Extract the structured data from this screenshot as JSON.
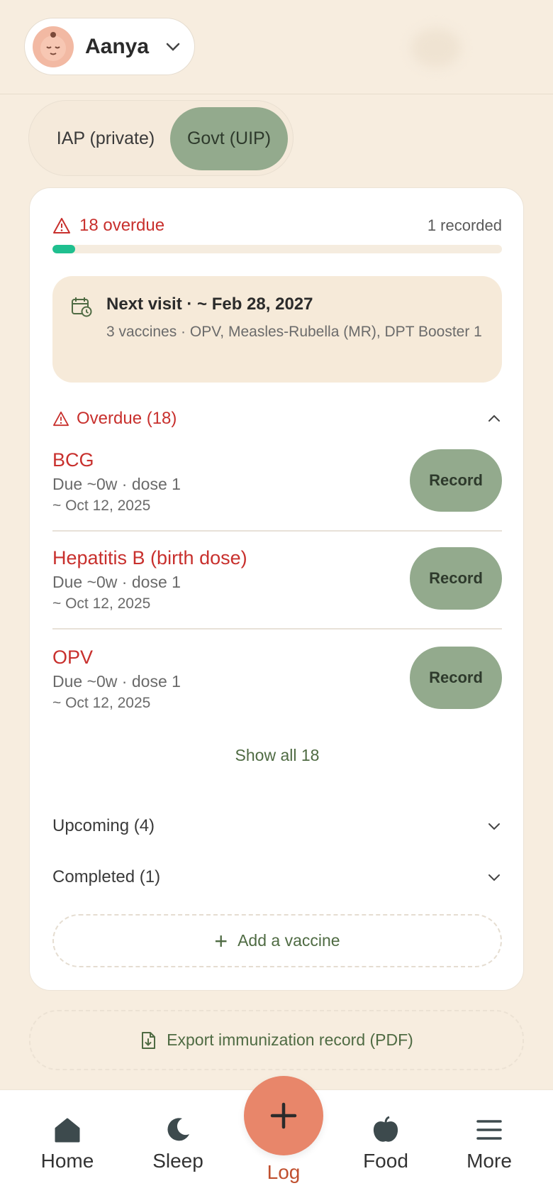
{
  "header": {
    "child_name": "Aanya"
  },
  "schedule_toggle": {
    "options": [
      "IAP (private)",
      "Govt (UIP)"
    ],
    "selected": "Govt (UIP)"
  },
  "summary": {
    "overdue_text": "18 overdue",
    "recorded_text": "1 recorded",
    "progress_fraction": 0.05,
    "progress_color": "#1fbf8f"
  },
  "next_visit": {
    "title": "Next visit · ~ Feb 28, 2027",
    "subtitle": "3 vaccines · OPV, Measles-Rubella (MR), DPT Booster 1"
  },
  "overdue_section": {
    "title": "Overdue (18)",
    "items": [
      {
        "name": "BCG",
        "due": "Due ~0w · dose 1",
        "date": "~ Oct 12, 2025",
        "action": "Record"
      },
      {
        "name": "Hepatitis B (birth dose)",
        "due": "Due ~0w · dose 1",
        "date": "~ Oct 12, 2025",
        "action": "Record"
      },
      {
        "name": "OPV",
        "due": "Due ~0w · dose 1",
        "date": "~ Oct 12, 2025",
        "action": "Record"
      }
    ],
    "show_all": "Show all 18"
  },
  "upcoming_section": {
    "title": "Upcoming (4)"
  },
  "completed_section": {
    "title": "Completed (1)"
  },
  "add_vaccine": "Add a vaccine",
  "export": "Export immunization record (PDF)",
  "bottom_nav": {
    "home": "Home",
    "sleep": "Sleep",
    "log": "Log",
    "food": "Food",
    "more": "More"
  },
  "colors": {
    "accent_green": "#93aa8d",
    "alert_red": "#c8302d",
    "fab": "#e8866a",
    "background": "#f7eddf"
  }
}
